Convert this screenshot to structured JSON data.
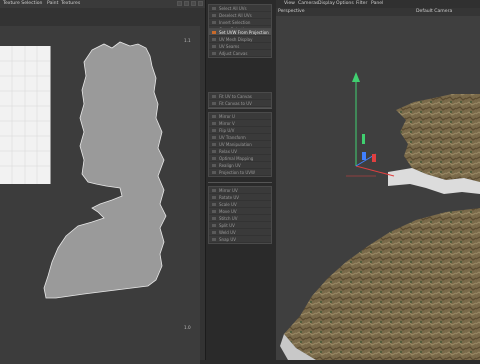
{
  "uv_editor": {
    "menu": [
      "Texture Selection",
      "Paint",
      "Textures"
    ],
    "coords": {
      "top_right": "1.1",
      "bottom_right": "1.0"
    }
  },
  "tools_panel": {
    "group1": [
      "Select All UVs",
      "Deselect All UVs",
      "Invert Selection",
      "Grow Selection",
      "Shrink Selection"
    ],
    "group2": [
      "Set UVW From Projection",
      "UV Mesh Display",
      "UV Seams",
      "Adjust Canvas"
    ],
    "group3": [
      "Fit UV to Canvas",
      "Fit Canvas to UV"
    ],
    "group4": [
      "Mirror U",
      "Mirror V",
      "Flip U/V",
      "UV Transform",
      "UV Manipulation",
      "Relax UV",
      "Optimal Mapping",
      "Realign UV",
      "Projection to UVW"
    ],
    "group5": [
      "Mirror UV",
      "Rotate UV",
      "Scale UV",
      "Move UV",
      "Stitch UV",
      "Split UV",
      "Weld UV",
      "Snap UV"
    ],
    "active_item": "Set UVW From Projection",
    "icon_item": "Fit UV to Canvas"
  },
  "viewport": {
    "menu": [
      "View",
      "Cameras",
      "Display",
      "Options",
      "Filter",
      "Panel"
    ],
    "label": "Perspective",
    "camera": "Default Camera"
  },
  "colors": {
    "accent": "#c96a2a",
    "axis_x": "#e04040",
    "axis_y": "#40d070",
    "axis_z": "#4080ff",
    "uv_shape": "#9a9a9a"
  }
}
